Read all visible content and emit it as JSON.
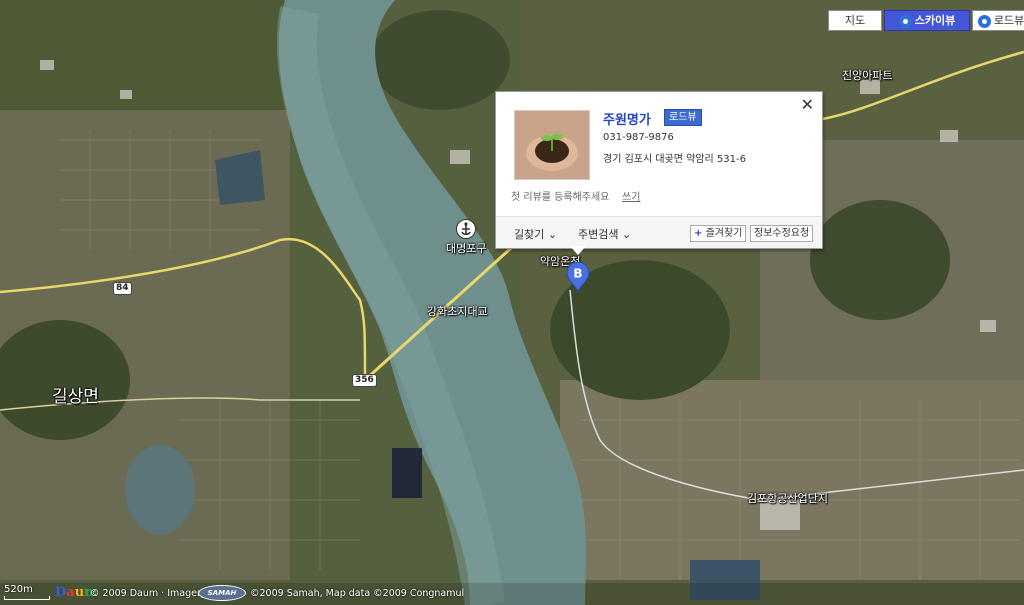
{
  "map_type": {
    "map": "지도",
    "skyview": "스카이뷰",
    "roadview": "로드뷰"
  },
  "labels": {
    "jinyang": "진양아파트",
    "daemyeong": "대명포구",
    "yagam": "약암온천",
    "gangwha_bridge": "강화초지대교",
    "gilsang": "길상면",
    "gimpo_industrial": "김포항공산업단지"
  },
  "road_shields": {
    "r84": "84",
    "r356": "356"
  },
  "popup": {
    "name": "주원명가",
    "roadview_badge": "로드뷰",
    "phone": "031-987-9876",
    "address": "경기 김포시 대곶면 약암리 531-6",
    "review": "첫 리뷰를 등록해주세요",
    "write": "쓰기",
    "route": "길찾기",
    "nearby": "주변검색",
    "favorite_plus": "+",
    "favorite": "즐겨찾기",
    "edit": "정보수정요청"
  },
  "marker_letter": "B",
  "footer": {
    "scale": "520m",
    "daum": "Daum",
    "copyright_daum": "© 2009 Daum · Imagery",
    "samah_logo": "SAMAH",
    "copyright_data": "©2009 Samah, Map data ©2009 Congnamul"
  }
}
